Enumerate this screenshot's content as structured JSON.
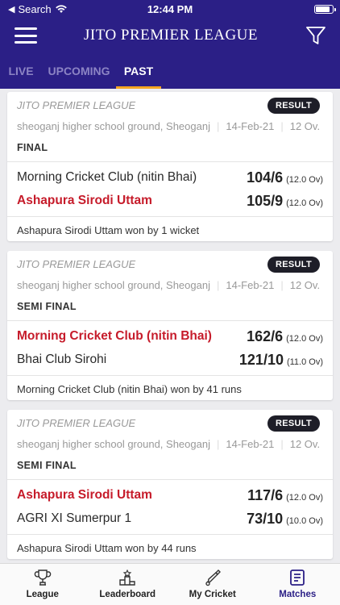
{
  "status_bar": {
    "carrier": "Search",
    "time": "12:44 PM",
    "battery_level": 0.9
  },
  "header": {
    "title": "JITO PREMIER LEAGUE",
    "menu_icon": "hamburger-icon",
    "filter_icon": "filter-icon"
  },
  "tabs": [
    {
      "label": "LIVE",
      "active": false
    },
    {
      "label": "UPCOMING",
      "active": false
    },
    {
      "label": "PAST",
      "active": true
    }
  ],
  "matches": [
    {
      "league": "JITO PREMIER LEAGUE",
      "badge": "RESULT",
      "venue": "sheoganj higher school ground, Sheoganj",
      "date": "14-Feb-21",
      "overs": "12 Ov.",
      "stage": "FINAL",
      "team1": {
        "name": "Morning Cricket Club (nitin Bhai)",
        "score": "104/6",
        "overs": "(12.0 Ov)",
        "winner": false
      },
      "team2": {
        "name": "Ashapura Sirodi Uttam",
        "score": "105/9",
        "overs": "(12.0 Ov)",
        "winner": true
      },
      "result": "Ashapura Sirodi Uttam won by 1 wicket"
    },
    {
      "league": "JITO PREMIER LEAGUE",
      "badge": "RESULT",
      "venue": "sheoganj higher school ground, Sheoganj",
      "date": "14-Feb-21",
      "overs": "12 Ov.",
      "stage": "SEMI FINAL",
      "team1": {
        "name": "Morning Cricket Club (nitin Bhai)",
        "score": "162/6",
        "overs": "(12.0 Ov)",
        "winner": true
      },
      "team2": {
        "name": "Bhai Club Sirohi",
        "score": "121/10",
        "overs": "(11.0 Ov)",
        "winner": false
      },
      "result": "Morning Cricket Club (nitin Bhai) won by 41 runs"
    },
    {
      "league": "JITO PREMIER LEAGUE",
      "badge": "RESULT",
      "venue": "sheoganj higher school ground, Sheoganj",
      "date": "14-Feb-21",
      "overs": "12 Ov.",
      "stage": "SEMI FINAL",
      "team1": {
        "name": "Ashapura Sirodi Uttam",
        "score": "117/6",
        "overs": "(12.0 Ov)",
        "winner": true
      },
      "team2": {
        "name": "AGRI XI Sumerpur 1",
        "score": "73/10",
        "overs": "(10.0 Ov)",
        "winner": false
      },
      "result": "Ashapura Sirodi Uttam won by 44 runs"
    }
  ],
  "bottom_nav": [
    {
      "label": "League",
      "icon": "trophy-icon",
      "active": false
    },
    {
      "label": "Leaderboard",
      "icon": "podium-icon",
      "active": false
    },
    {
      "label": "My Cricket",
      "icon": "cricket-bat-icon",
      "active": false
    },
    {
      "label": "Matches",
      "icon": "scorecard-icon",
      "active": true
    }
  ],
  "colors": {
    "header_bg": "#2b1f86",
    "tab_indicator": "#f5a623",
    "winner_text": "#c61b2a",
    "badge_bg": "#1e1e28"
  }
}
